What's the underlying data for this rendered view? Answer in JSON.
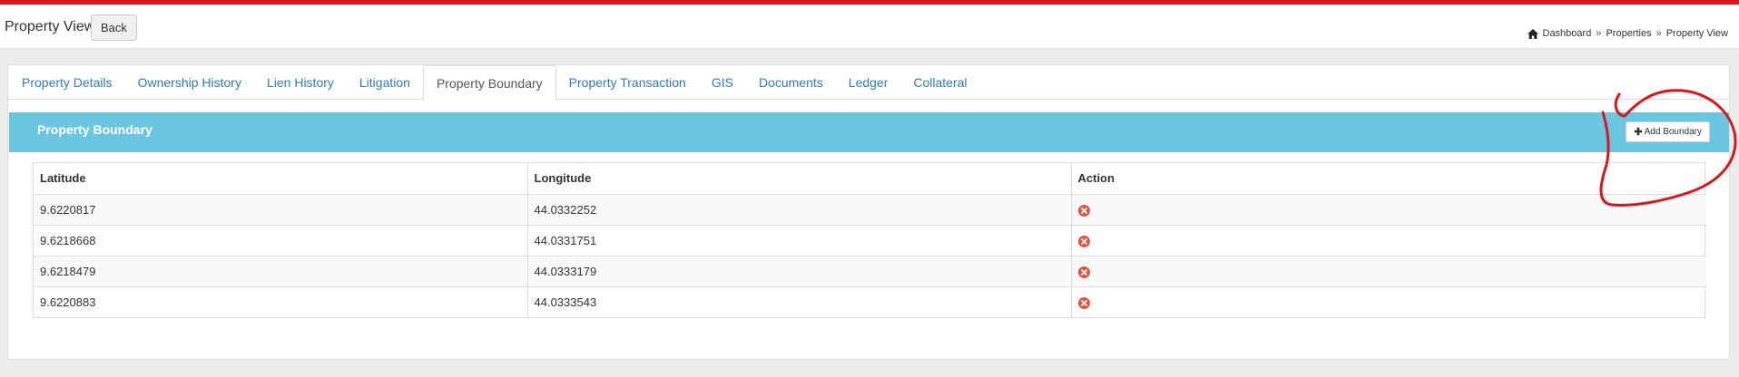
{
  "header": {
    "title": "Property View",
    "back_label": "Back",
    "breadcrumb": [
      "Dashboard",
      "Properties",
      "Property View"
    ],
    "breadcrumb_separator": "»"
  },
  "tabs": [
    {
      "label": "Property Details",
      "active": false
    },
    {
      "label": "Ownership History",
      "active": false
    },
    {
      "label": "Lien History",
      "active": false
    },
    {
      "label": "Litigation",
      "active": false
    },
    {
      "label": "Property Boundary",
      "active": true
    },
    {
      "label": "Property Transaction",
      "active": false
    },
    {
      "label": "GIS",
      "active": false
    },
    {
      "label": "Documents",
      "active": false
    },
    {
      "label": "Ledger",
      "active": false
    },
    {
      "label": "Collateral",
      "active": false
    }
  ],
  "panel": {
    "title": "Property Boundary",
    "add_label": "Add Boundary",
    "add_icon": "plus-icon"
  },
  "table": {
    "columns": [
      "Latitude",
      "Longitude",
      "Action"
    ],
    "rows": [
      {
        "latitude": "9.6220817",
        "longitude": "44.0332252",
        "action_icon": "delete-icon"
      },
      {
        "latitude": "9.6218668",
        "longitude": "44.0331751",
        "action_icon": "delete-icon"
      },
      {
        "latitude": "9.6218479",
        "longitude": "44.0333179",
        "action_icon": "delete-icon"
      },
      {
        "latitude": "9.6220883",
        "longitude": "44.0333543",
        "action_icon": "delete-icon"
      }
    ]
  },
  "colors": {
    "top_bar": "#d9161b",
    "panel_header": "#6ac5e1",
    "link": "#337ab7",
    "delete_icon": "#e5533d",
    "annotation": "#d9161b"
  }
}
